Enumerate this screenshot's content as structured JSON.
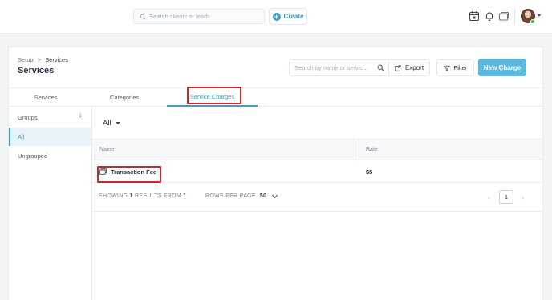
{
  "topbar": {
    "search_placeholder": "Search clients or leads",
    "create_label": "Create",
    "icons": [
      "calendar-icon",
      "bell-icon",
      "cards-icon",
      "avatar",
      "chevron-down-icon"
    ]
  },
  "header": {
    "breadcrumb_root": "Setup",
    "breadcrumb_sep": ">",
    "breadcrumb_current": "Services",
    "title": "Services",
    "search_placeholder": "Search by name or servic...",
    "export_label": "Export",
    "filter_label": "Filter",
    "new_charge_label": "New Charge"
  },
  "tabs": [
    {
      "label": "Services",
      "active": false
    },
    {
      "label": "Categories",
      "active": false
    },
    {
      "label": "Service Charges",
      "active": true
    }
  ],
  "sidebar": {
    "groups_label": "Groups",
    "add_symbol": "+",
    "items": [
      {
        "label": "All",
        "selected": true
      },
      {
        "label": "Ungrouped",
        "selected": false
      }
    ]
  },
  "content": {
    "filter_value": "All",
    "columns": [
      "Name",
      "Rate"
    ],
    "rows": [
      {
        "name": "Transaction Fee",
        "rate": "$5"
      }
    ]
  },
  "footer": {
    "showing_prefix": "SHOWING",
    "showing_count": "1",
    "showing_mid": "RESULTS FROM",
    "showing_total": "1",
    "rows_per_page_label": "ROWS PER PAGE",
    "rows_per_page_value": "50",
    "current_page": "1",
    "prev_symbol": "‹",
    "next_symbol": "›"
  },
  "colors": {
    "accent": "#3aa0c9",
    "primary_button": "#5bb9e0",
    "highlight": "#d0262b",
    "selected_bg": "#e8f3f9"
  }
}
